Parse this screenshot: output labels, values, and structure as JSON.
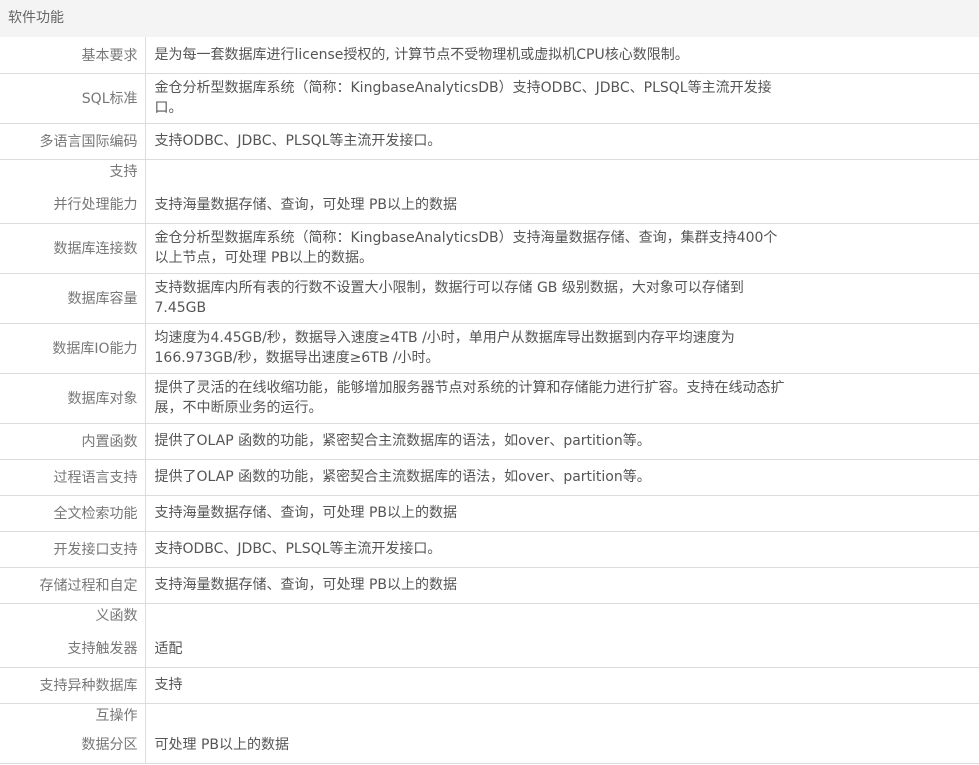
{
  "section": {
    "title": "软件功能"
  },
  "rows": [
    {
      "label": "基本要求",
      "value": "是为每一套数据库进行license授权的, 计算节点不受物理机或虚拟机CPU核心数限制。"
    },
    {
      "label": "SQL标准",
      "value": "金仓分析型数据库系统（简称：KingbaseAnalyticsDB）支持ODBC、JDBC、PLSQL等主流开发接口。"
    },
    {
      "label": "多语言国际编码",
      "value": "支持ODBC、JDBC、PLSQL等主流开发接口。"
    },
    {
      "label_top": "支持",
      "label": "并行处理能力",
      "value": "支持海量数据存储、查询，可处理 PB以上的数据"
    },
    {
      "label": "数据库连接数",
      "value": "金仓分析型数据库系统（简称：KingbaseAnalyticsDB）支持海量数据存储、查询，集群支持400个以上节点，可处理 PB以上的数据。"
    },
    {
      "label": "数据库容量",
      "value": "支持数据库内所有表的行数不设置大小限制，数据行可以存储 GB 级别数据，大对象可以存储到7.45GB"
    },
    {
      "label": "数据库IO能力",
      "value": "均速度为4.45GB/秒，数据导入速度≥4TB /小时，单用户从数据库导出数据到内存平均速度为166.973GB/秒，数据导出速度≥6TB /小时。"
    },
    {
      "label": "数据库对象",
      "value": "提供了灵活的在线收缩功能，能够增加服务器节点对系统的计算和存储能力进行扩容。支持在线动态扩展，不中断原业务的运行。"
    },
    {
      "label": "内置函数",
      "value": "提供了OLAP 函数的功能，紧密契合主流数据库的语法，如over、partition等。"
    },
    {
      "label": "过程语言支持",
      "value": "提供了OLAP 函数的功能，紧密契合主流数据库的语法，如over、partition等。"
    },
    {
      "label": "全文检索功能",
      "value": "支持海量数据存储、查询，可处理 PB以上的数据"
    },
    {
      "label": "开发接口支持",
      "value": "支持ODBC、JDBC、PLSQL等主流开发接口。"
    },
    {
      "label": "存储过程和自定",
      "value": "支持海量数据存储、查询，可处理 PB以上的数据"
    },
    {
      "label_top": "义函数",
      "label": "支持触发器",
      "value": "适配"
    },
    {
      "label": "支持异种数据库",
      "value": "支持"
    },
    {
      "label_top": "互操作",
      "label": "数据分区",
      "value": "可处理 PB以上的数据"
    }
  ]
}
